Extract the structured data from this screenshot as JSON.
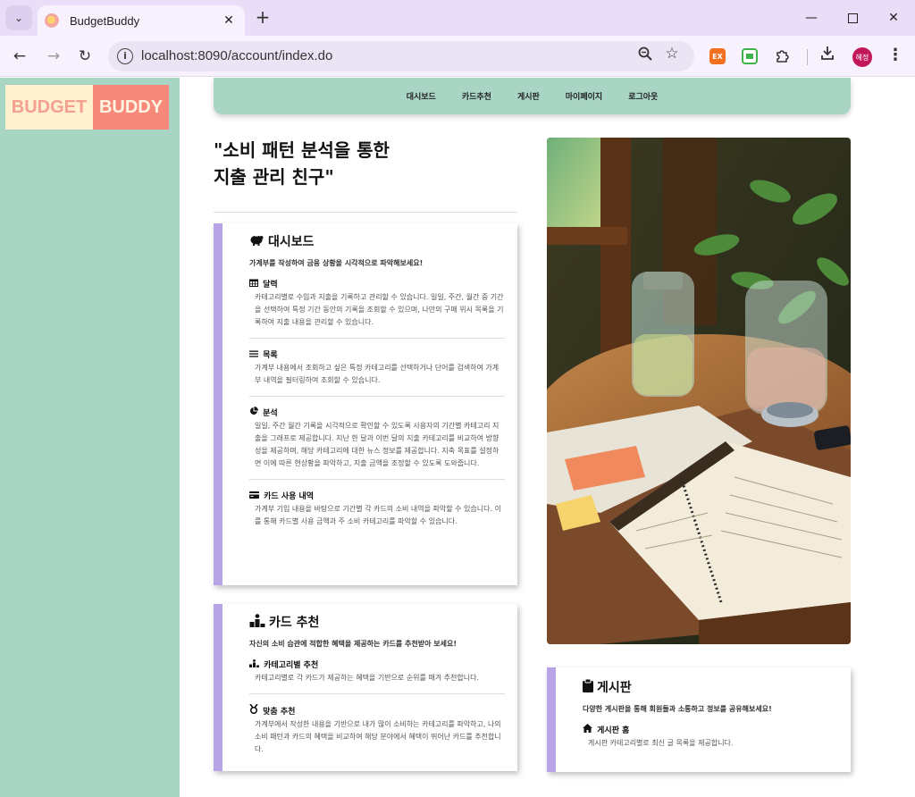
{
  "browser": {
    "tab_title": "BudgetBuddy",
    "url": "localhost:8090/account/index.do",
    "profile_initials": "혜정",
    "ext_label": "EX"
  },
  "logo": {
    "left": "BUDGET",
    "right": "BUDDY"
  },
  "nav": [
    "대시보드",
    "카드추천",
    "게시판",
    "마이페이지",
    "로그아웃"
  ],
  "hero": {
    "line1": "\"소비 패턴 분석을 통한",
    "line2": "지출 관리 친구\""
  },
  "dashboard": {
    "title": "대시보드",
    "subtitle": "가계부를 작성하여 금융 상황을 시각적으로 파악해보세요!",
    "sections": [
      {
        "title": "달력",
        "body": "카테고리별로 수입과 지출을 기록하고 관리할 수 있습니다. 일일, 주간, 월간 중 기간을 선택하여 특정 기간 동안의 기록을 조회할 수 있으며, 나만의 구매 위시 목록을 기록하여 지출 내용을 관리할 수 있습니다."
      },
      {
        "title": "목록",
        "body": "가계부 내용에서 조회하고 싶은 특정 카테고리를 선택하거나 단어를 검색하여 가계부 내역을 필터링하여 조회할 수 있습니다."
      },
      {
        "title": "분석",
        "body": "일일, 주간 월간 기록을 시각적으로 확인할 수 있도록 사용자의 기간별 카테고리 지출을 그래프로 제공합니다. 지난 한 달과 이번 달의 지출 카테고리를 비교하여 방향성을 제공하며, 해당 카테고리에 대한 뉴스 정보를 제공합니다. 지축 목표를 설정하면 이에 따른 현상황을 파악하고, 지출 금액을 조정할 수 있도록 도와줍니다."
      },
      {
        "title": "카드 사용 내역",
        "body": "가계부 기입 내용을 바탕으로 기간별 각 카드의 소비 내역을 파악할 수 있습니다. 이를 통해 카드별 사용 금액과 주 소비 카테고리를 파악할 수 있습니다."
      }
    ]
  },
  "card_reco": {
    "title": "카드 추천",
    "subtitle": "자신의 소비 습관에 적합한 혜택을 제공하는 카드를 추천받아 보세요!",
    "sections": [
      {
        "title": "카테고리별 추천",
        "body": "카테고리별로 각 카드가 제공하는 혜택을 기반으로 순위를 매겨 추천합니다."
      },
      {
        "title": "맞춤 추천",
        "body": "가계부에서 작성한 내용을 기반으로 내가 많이 소비하는 카테고리를 파악하고, 나의 소비 패턴과 카드의 혜택을 비교하여 해당 분야에서 혜택이 뛰어난 카드를 추천합니다."
      }
    ]
  },
  "board": {
    "title": "게시판",
    "subtitle": "다양한 게시판을 통해 회원들과 소통하고 정보를 공유해보세요!",
    "sections": [
      {
        "title": "게시판 홈",
        "body": "게시판 카테고리별로 최신 글 목록을 제공합니다."
      }
    ]
  }
}
